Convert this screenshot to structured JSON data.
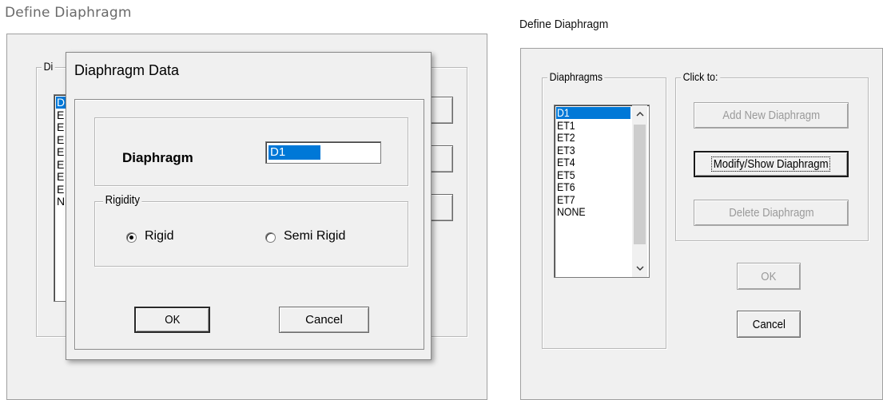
{
  "left_window": {
    "title": "Define Diaphragm",
    "group_label_partial": "Di",
    "list_partial_items": [
      "D",
      "E",
      "E",
      "E",
      "E",
      "E",
      "E",
      "E",
      "N"
    ]
  },
  "dialog": {
    "title": "Diaphragm Data",
    "diaphragm_label": "Diaphragm",
    "diaphragm_value": "D1",
    "rigidity_label": "Rigidity",
    "rigid_label": "Rigid",
    "semi_rigid_label": "Semi Rigid",
    "selected_rigidity": "Rigid",
    "ok_label": "OK",
    "cancel_label": "Cancel"
  },
  "right_window": {
    "title": "Define Diaphragm",
    "diaphragms_label": "Diaphragms",
    "click_to_label": "Click to:",
    "items": [
      "D1",
      "ET1",
      "ET2",
      "ET3",
      "ET4",
      "ET5",
      "ET6",
      "ET7",
      "NONE"
    ],
    "selected_item": "D1",
    "add_label": "Add New Diaphragm",
    "modify_label": "Modify/Show Diaphragm",
    "delete_label": "Delete Diaphragm",
    "ok_label": "OK",
    "cancel_label": "Cancel"
  }
}
